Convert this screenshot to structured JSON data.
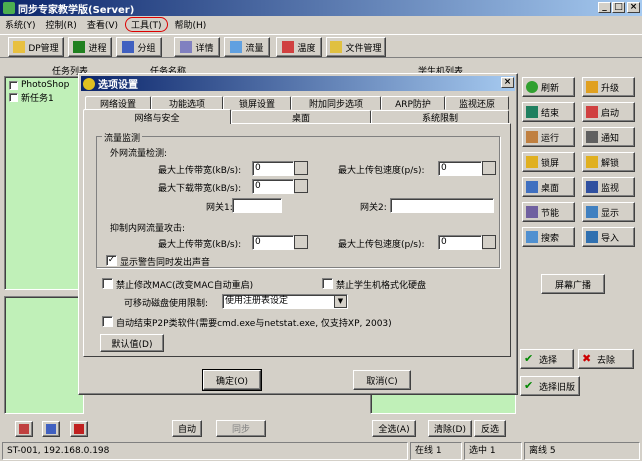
{
  "window": {
    "title": "同步专家教学版(Server)"
  },
  "menu": [
    "系统(Y)",
    "控制(R)",
    "查看(V)",
    "工具(T)",
    "帮助(H)"
  ],
  "toolbar": [
    "DP管理",
    "进程",
    "分组",
    "详情",
    "流量",
    "温度",
    "文件管理"
  ],
  "left_panel": {
    "col1": "任务列表",
    "col2": "任务名称",
    "items": [
      "PhotoShop",
      "新任务1"
    ]
  },
  "right_header": "学生机列表",
  "side_buttons": [
    [
      "刷新",
      "升级"
    ],
    [
      "结束",
      "启动"
    ],
    [
      "运行",
      "通知"
    ],
    [
      "锁屏",
      "解锁"
    ],
    [
      "桌面",
      "监视"
    ],
    [
      "节能",
      "显示"
    ],
    [
      "搜索",
      "导入"
    ]
  ],
  "screen_broadcast": "屏幕广播",
  "select_btn": "选择",
  "remove_btn": "去除",
  "select_old_btn": "选择旧版",
  "bottom": {
    "auto": "自动",
    "sync": "同步",
    "select_all": "全选(A)",
    "clear": "清除(D)",
    "invert": "反选"
  },
  "statusbar": {
    "station": "ST-001, 192.168.0.198",
    "online": "在线 1",
    "selected": "选中 1",
    "offline": "离线 5"
  },
  "dialog": {
    "title": "选项设置",
    "tabs_row1": [
      "网络设置",
      "功能选项",
      "锁屏设置",
      "附加同步选项",
      "ARP防护",
      "监视还原"
    ],
    "tabs_row2": [
      "网络与安全",
      "桌面",
      "系统限制"
    ],
    "group_title": "流量监测",
    "ext_label": "外网流量检测:",
    "max_up_bw": "最大上传带宽(kB/s):",
    "max_up_bw_val": "0",
    "max_up_pps": "最大上传包速度(p/s):",
    "max_up_pps_val": "0",
    "max_down_bw": "最大下载带宽(kB/s):",
    "max_down_bw_val": "0",
    "gw1": "网关1:",
    "gw2": "网关2:",
    "int_label": "抑制内网流量攻击:",
    "max_up_bw2": "最大上传带宽(kB/s):",
    "max_up_bw2_val": "0",
    "max_up_pps2": "最大上传包速度(p/s):",
    "max_up_pps2_val": "0",
    "warn_sound": "显示警告同时发出声音",
    "no_mac": "禁止修改MAC(改变MAC自动重启)",
    "no_format": "禁止学生机格式化硬盘",
    "removable_label": "可移动磁盘使用限制:",
    "removable_value": "使用注册表设定",
    "p2p": "自动结束P2P类软件(需要cmd.exe与netstat.exe, 仅支持XP, 2003)",
    "default_btn": "默认值(D)",
    "ok_btn": "确定(O)",
    "cancel_btn": "取消(C)"
  }
}
